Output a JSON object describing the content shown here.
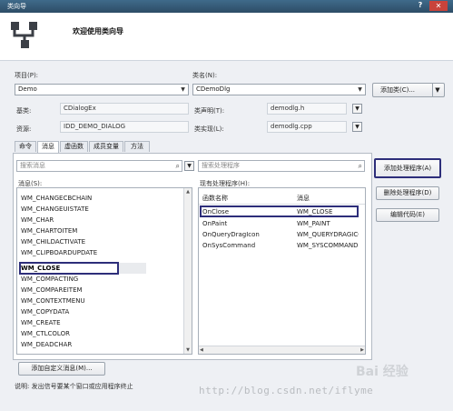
{
  "window": {
    "title": "类向导",
    "help": "?",
    "close": "✕"
  },
  "header": {
    "welcome": "欢迎使用类向导"
  },
  "project": {
    "label": "项目(P):",
    "value": "Demo"
  },
  "classname": {
    "label": "类名(N):",
    "value": "CDemoDlg"
  },
  "add_class_button": "添加类(C)...",
  "base": {
    "label": "基类:",
    "value": "CDialogEx"
  },
  "class_decl": {
    "label": "类声明(T):",
    "value": "demodlg.h"
  },
  "resource": {
    "label": "资源:",
    "value": "IDD_DEMO_DIALOG"
  },
  "class_impl": {
    "label": "类实现(L):",
    "value": "demodlg.cpp"
  },
  "tabs": [
    "命令",
    "消息",
    "虚函数",
    "成员变量",
    "方法"
  ],
  "search_messages": {
    "placeholder": "搜索消息"
  },
  "search_handlers": {
    "placeholder": "搜索处理程序"
  },
  "messages": {
    "label": "消息(S):",
    "items": [
      "WM_CHANGECBCHAIN",
      "WM_CHANGEUISTATE",
      "WM_CHAR",
      "WM_CHARTOITEM",
      "WM_CHILDACTIVATE",
      "WM_CLIPBOARDUPDATE",
      "WM_CLOSE",
      "WM_COMPACTING",
      "WM_COMPAREITEM",
      "WM_CONTEXTMENU",
      "WM_COPYDATA",
      "WM_CREATE",
      "WM_CTLCOLOR",
      "WM_DEADCHAR"
    ],
    "selected": "WM_CLOSE"
  },
  "handlers": {
    "label": "现有处理程序(H):",
    "columns": [
      "函数名称",
      "消息"
    ],
    "rows": [
      [
        "OnClose",
        "WM_CLOSE"
      ],
      [
        "OnPaint",
        "WM_PAINT"
      ],
      [
        "OnQueryDragIcon",
        "WM_QUERYDRAGICO"
      ],
      [
        "OnSysCommand",
        "WM_SYSCOMMAND"
      ]
    ]
  },
  "buttons": {
    "add_handler": "添加处理程序(A)",
    "delete_handler": "删除处理程序(D)",
    "edit_code": "编辑代码(E)",
    "add_custom_message": "添加自定义消息(M)..."
  },
  "description": "说明:   发出信号要某个窗口或应用程序终止",
  "watermark": "http://blog.csdn.net/iflyme",
  "baidu_mark": "Bai 经验",
  "colors": {
    "highlight_border": "#2d2e7a",
    "titlebar": "#3f6a8a"
  }
}
